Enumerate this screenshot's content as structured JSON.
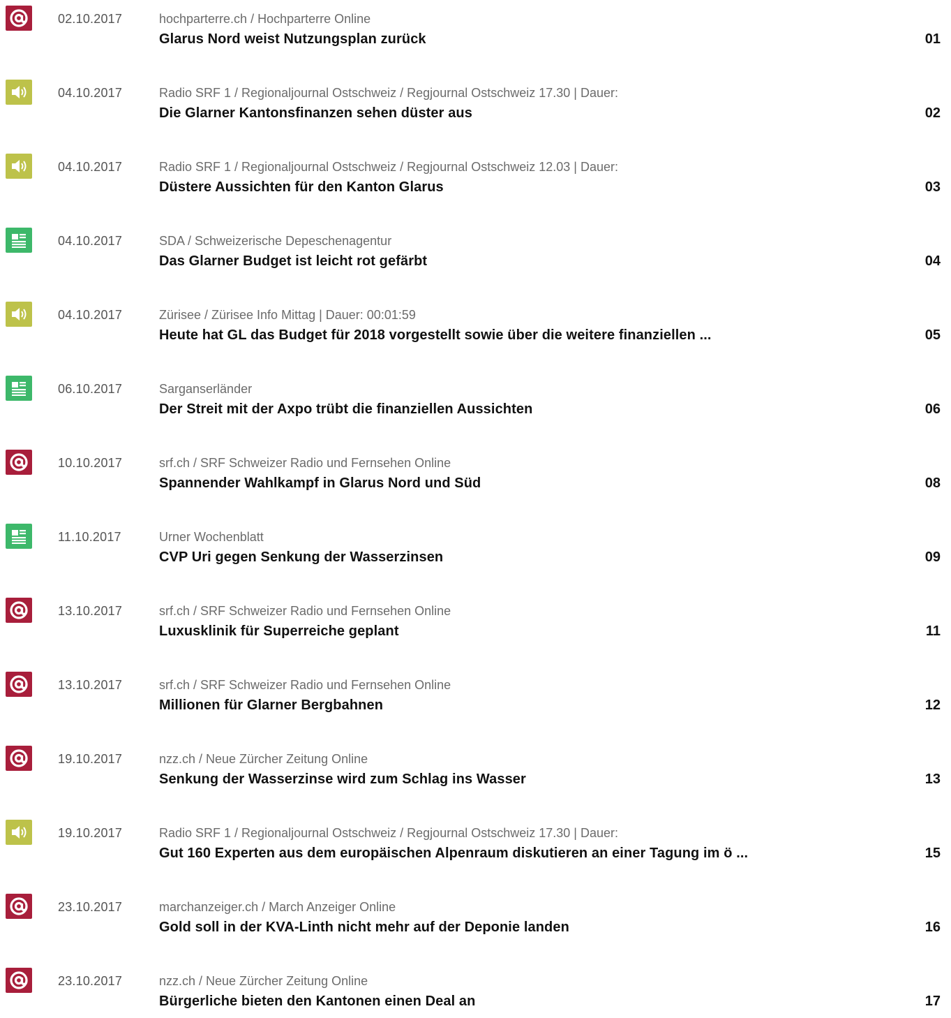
{
  "items": [
    {
      "type": "web",
      "icon": "at-sign-icon",
      "date": "02.10.2017",
      "source": "hochparterre.ch / Hochparterre Online",
      "title": "Glarus Nord weist Nutzungsplan zurück",
      "page": "01"
    },
    {
      "type": "audio",
      "icon": "speaker-icon",
      "date": "04.10.2017",
      "source": "Radio SRF 1 / Regionaljournal Ostschweiz / Regjournal Ostschweiz 17.30 | Dauer:",
      "title": "Die Glarner Kantonsfinanzen sehen düster aus",
      "page": "02"
    },
    {
      "type": "audio",
      "icon": "speaker-icon",
      "date": "04.10.2017",
      "source": "Radio SRF 1 / Regionaljournal Ostschweiz / Regjournal Ostschweiz 12.03 | Dauer:",
      "title": "Düstere Aussichten für den Kanton Glarus",
      "page": "03"
    },
    {
      "type": "print",
      "icon": "newspaper-icon",
      "date": "04.10.2017",
      "source": "SDA / Schweizerische Depeschenagentur",
      "title": "Das Glarner Budget ist leicht rot gefärbt",
      "page": "04"
    },
    {
      "type": "audio",
      "icon": "speaker-icon",
      "date": "04.10.2017",
      "source": "Zürisee / Zürisee Info Mittag | Dauer: 00:01:59",
      "title": "Heute hat GL das Budget für 2018 vorgestellt sowie über die weitere finanziellen ...",
      "page": "05"
    },
    {
      "type": "print",
      "icon": "newspaper-icon",
      "date": "06.10.2017",
      "source": "Sarganserländer",
      "title": "Der Streit mit der Axpo trübt die finanziellen Aussichten",
      "page": "06"
    },
    {
      "type": "web",
      "icon": "at-sign-icon",
      "date": "10.10.2017",
      "source": "srf.ch / SRF Schweizer Radio und Fernsehen Online",
      "title": "Spannender Wahlkampf in Glarus Nord und Süd",
      "page": "08"
    },
    {
      "type": "print",
      "icon": "newspaper-icon",
      "date": "11.10.2017",
      "source": "Urner Wochenblatt",
      "title": "CVP Uri gegen Senkung der Wasserzinsen",
      "page": "09"
    },
    {
      "type": "web",
      "icon": "at-sign-icon",
      "date": "13.10.2017",
      "source": "srf.ch / SRF Schweizer Radio und Fernsehen Online",
      "title": "Luxusklinik für Superreiche geplant",
      "page": "11"
    },
    {
      "type": "web",
      "icon": "at-sign-icon",
      "date": "13.10.2017",
      "source": "srf.ch / SRF Schweizer Radio und Fernsehen Online",
      "title": "Millionen für Glarner Bergbahnen",
      "page": "12"
    },
    {
      "type": "web",
      "icon": "at-sign-icon",
      "date": "19.10.2017",
      "source": "nzz.ch / Neue Zürcher Zeitung Online",
      "title": "Senkung der Wasserzinse wird zum Schlag ins Wasser",
      "page": "13"
    },
    {
      "type": "audio",
      "icon": "speaker-icon",
      "date": "19.10.2017",
      "source": "Radio SRF 1 / Regionaljournal Ostschweiz / Regjournal Ostschweiz 17.30 | Dauer:",
      "title": "Gut 160 Experten aus dem europäischen Alpenraum diskutieren an einer Tagung im ö ...",
      "page": "15"
    },
    {
      "type": "web",
      "icon": "at-sign-icon",
      "date": "23.10.2017",
      "source": "marchanzeiger.ch / March Anzeiger Online",
      "title": "Gold soll in der KVA-Linth nicht mehr auf der Deponie landen",
      "page": "16"
    },
    {
      "type": "web",
      "icon": "at-sign-icon",
      "date": "23.10.2017",
      "source": "nzz.ch / Neue Zürcher Zeitung Online",
      "title": "Bürgerliche bieten den Kantonen einen Deal an",
      "page": "17"
    }
  ],
  "colors": {
    "web": "#a81e3b",
    "audio": "#bdc24a",
    "print": "#3db86a"
  }
}
